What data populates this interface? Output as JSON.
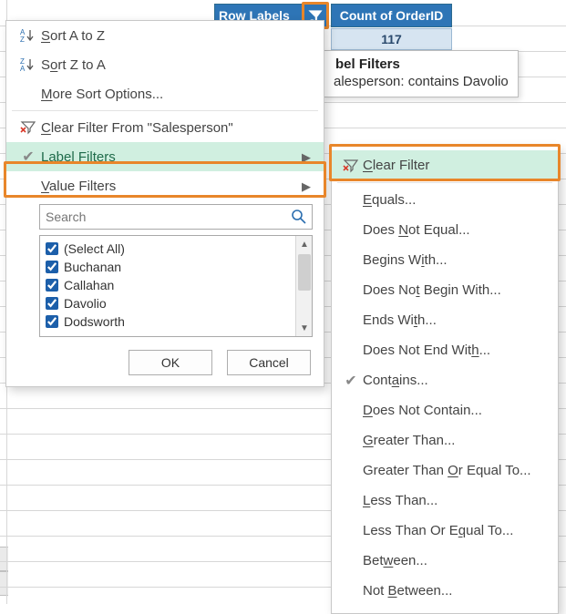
{
  "header": {
    "row_labels": "Row Labels",
    "count_label": "Count of OrderID",
    "count_value": "117"
  },
  "tooltip": {
    "title": "bel Filters",
    "body": "alesperson: contains Davolio"
  },
  "menu": {
    "sort_az": "Sort A to Z",
    "sort_za": "Sort Z to A",
    "more_sort": "More Sort Options...",
    "clear_filter_from": "Clear Filter From \"Salesperson\"",
    "label_filters": "Label Filters",
    "value_filters": "Value Filters",
    "search_placeholder": "Search",
    "items": [
      "(Select All)",
      "Buchanan",
      "Callahan",
      "Davolio",
      "Dodsworth"
    ],
    "ok": "OK",
    "cancel": "Cancel"
  },
  "submenu": {
    "clear_filter": "Clear Filter",
    "equals": "Equals...",
    "not_equal": "Does Not Equal...",
    "begins_with": "Begins With...",
    "not_begin_with": "Does Not Begin With...",
    "ends_with": "Ends With...",
    "not_end_with": "Does Not End With...",
    "contains": "Contains...",
    "not_contain": "Does Not Contain...",
    "greater_than": "Greater Than...",
    "gte": "Greater Than Or Equal To...",
    "less_than": "Less Than...",
    "lte": "Less Than Or Equal To...",
    "between": "Between...",
    "not_between": "Not Between..."
  }
}
